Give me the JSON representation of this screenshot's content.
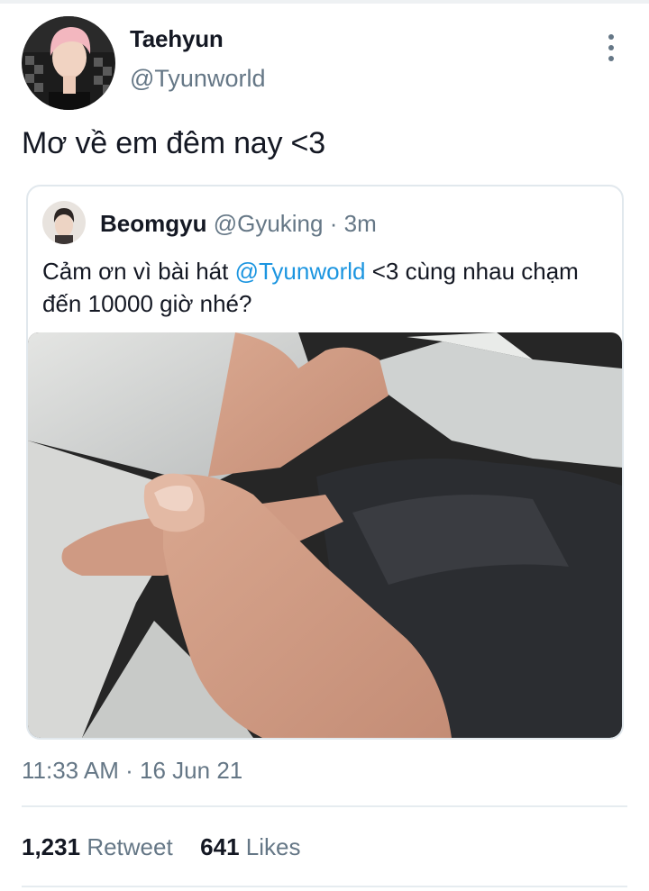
{
  "tweet": {
    "author_name": "Taehyun",
    "author_handle": "@Tyunworld",
    "text": "Mơ về em đêm nay <3",
    "timestamp": "11:33 AM · 16 Jun 21",
    "menu_icon": "more-vertical-icon"
  },
  "quoted_tweet": {
    "author_name": "Beomgyu",
    "author_handle": "@Gyuking",
    "separator": " · ",
    "age": "3m",
    "text_before": "Cảm ơn vì bài hát ",
    "mention": "@Tyunworld",
    "text_after": " <3 cùng nhau chạm đến 10000 giờ nhé?"
  },
  "stats": {
    "retweets_count": "1,231",
    "retweets_label": "Retweet",
    "likes_count": "641",
    "likes_label": "Likes"
  },
  "colors": {
    "text_primary": "#141823",
    "text_secondary": "#657786",
    "link": "#1b95e0",
    "border": "#e1e8ed"
  }
}
